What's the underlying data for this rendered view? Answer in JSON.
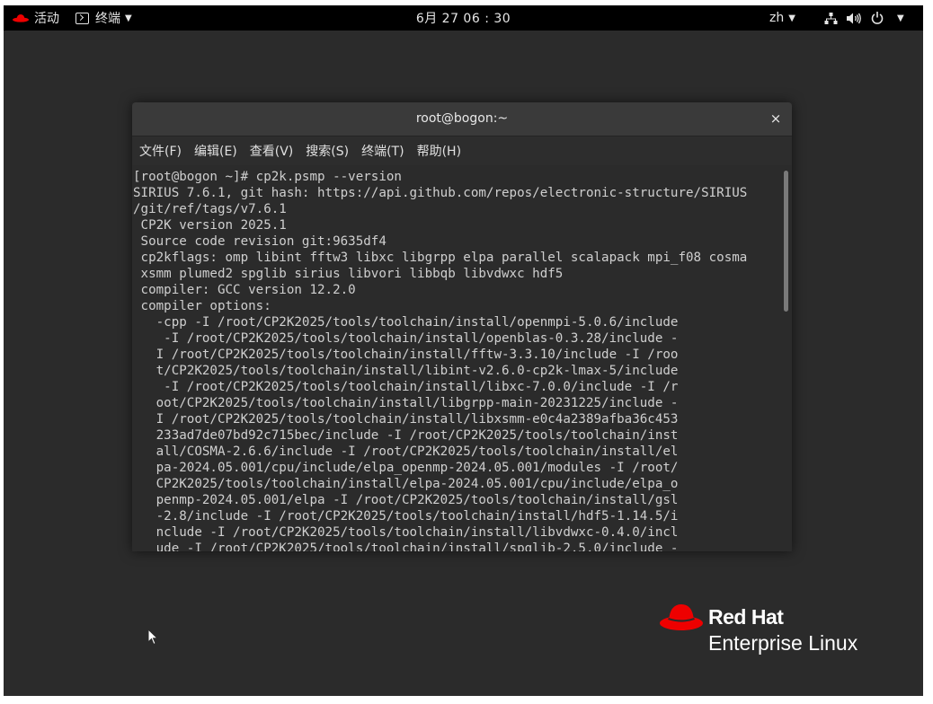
{
  "topbar": {
    "activities_label": "活动",
    "app_menu_label": "终端",
    "clock": "6月 27 06 : 30",
    "language": "zh"
  },
  "terminal": {
    "title": "root@bogon:~",
    "close_glyph": "×",
    "menu": [
      "文件(F)",
      "编辑(E)",
      "查看(V)",
      "搜索(S)",
      "终端(T)",
      "帮助(H)"
    ],
    "lines": [
      "[root@bogon ~]# cp2k.psmp --version",
      "SIRIUS 7.6.1, git hash: https://api.github.com/repos/electronic-structure/SIRIUS",
      "/git/ref/tags/v7.6.1",
      " CP2K version 2025.1",
      " Source code revision git:9635df4",
      " cp2kflags: omp libint fftw3 libxc libgrpp elpa parallel scalapack mpi_f08 cosma",
      " xsmm plumed2 spglib sirius libvori libbqb libvdwxc hdf5",
      " compiler: GCC version 12.2.0",
      " compiler options:",
      "   -cpp -I /root/CP2K2025/tools/toolchain/install/openmpi-5.0.6/include",
      "    -I /root/CP2K2025/tools/toolchain/install/openblas-0.3.28/include -",
      "   I /root/CP2K2025/tools/toolchain/install/fftw-3.3.10/include -I /roo",
      "   t/CP2K2025/tools/toolchain/install/libint-v2.6.0-cp2k-lmax-5/include",
      "    -I /root/CP2K2025/tools/toolchain/install/libxc-7.0.0/include -I /r",
      "   oot/CP2K2025/tools/toolchain/install/libgrpp-main-20231225/include -",
      "   I /root/CP2K2025/tools/toolchain/install/libxsmm-e0c4a2389afba36c453",
      "   233ad7de07bd92c715bec/include -I /root/CP2K2025/tools/toolchain/inst",
      "   all/COSMA-2.6.6/include -I /root/CP2K2025/tools/toolchain/install/el",
      "   pa-2024.05.001/cpu/include/elpa_openmp-2024.05.001/modules -I /root/",
      "   CP2K2025/tools/toolchain/install/elpa-2024.05.001/cpu/include/elpa_o",
      "   penmp-2024.05.001/elpa -I /root/CP2K2025/tools/toolchain/install/gsl",
      "   -2.8/include -I /root/CP2K2025/tools/toolchain/install/hdf5-1.14.5/i",
      "   nclude -I /root/CP2K2025/tools/toolchain/install/libvdwxc-0.4.0/incl",
      "   ude -I /root/CP2K2025/tools/toolchain/install/spglib-2.5.0/include -"
    ]
  },
  "branding": {
    "wordmark": "Red Hat",
    "product": "Enterprise Linux",
    "brand_red": "#ee0000"
  },
  "icons": [
    "redhat-icon",
    "terminal-icon",
    "network-icon",
    "volume-icon",
    "power-icon",
    "mouse-pointer-icon"
  ]
}
